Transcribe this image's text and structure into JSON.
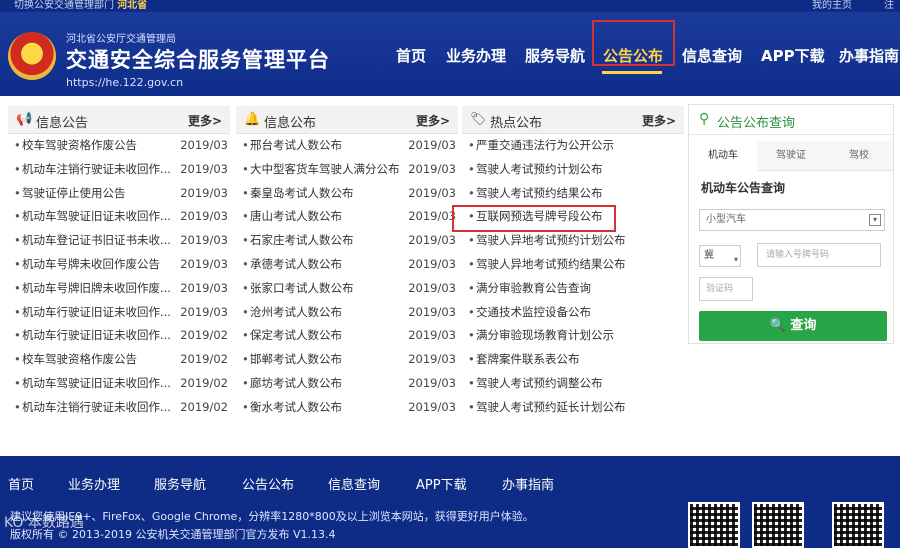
{
  "topbar": {
    "left": "切换公安交通管理部门",
    "province": "河北省",
    "right": "我的主页",
    "right2": "注"
  },
  "header": {
    "subtitle": "河北省公安厅交通管理局",
    "title": "交通安全综合服务管理平台",
    "url": "https://he.122.gov.cn",
    "nav": [
      "首页",
      "业务办理",
      "服务导航",
      "公告公布",
      "信息查询",
      "APP下载",
      "办事指南"
    ],
    "active_nav": "公告公布"
  },
  "columns": [
    {
      "title": "信息公告",
      "icon": "megaphone-icon",
      "more": "更多>",
      "rows": [
        {
          "text": "校车驾驶资格作废公告",
          "date": "2019/03"
        },
        {
          "text": "机动车注销行驶证未收回作...",
          "date": "2019/03"
        },
        {
          "text": "驾驶证停止使用公告",
          "date": "2019/03"
        },
        {
          "text": "机动车驾驶证旧证未收回作...",
          "date": "2019/03"
        },
        {
          "text": "机动车登记证书旧证书未收...",
          "date": "2019/03"
        },
        {
          "text": "机动车号牌未收回作废公告",
          "date": "2019/03"
        },
        {
          "text": "机动车号牌旧牌未收回作废...",
          "date": "2019/03"
        },
        {
          "text": "机动车行驶证旧证未收回作...",
          "date": "2019/03"
        },
        {
          "text": "机动车行驶证旧证未收回作...",
          "date": "2019/02"
        },
        {
          "text": "校车驾驶资格作废公告",
          "date": "2019/02"
        },
        {
          "text": "机动车驾驶证旧证未收回作...",
          "date": "2019/02"
        },
        {
          "text": "机动车注销行驶证未收回作...",
          "date": "2019/02"
        }
      ]
    },
    {
      "title": "信息公布",
      "icon": "bell-icon",
      "more": "更多>",
      "rows": [
        {
          "text": "邢台考试人数公布",
          "date": "2019/03"
        },
        {
          "text": "大中型客货车驾驶人满分公布",
          "date": "2019/03"
        },
        {
          "text": "秦皇岛考试人数公布",
          "date": "2019/03"
        },
        {
          "text": "唐山考试人数公布",
          "date": "2019/03"
        },
        {
          "text": "石家庄考试人数公布",
          "date": "2019/03"
        },
        {
          "text": "承德考试人数公布",
          "date": "2019/03"
        },
        {
          "text": "张家口考试人数公布",
          "date": "2019/03"
        },
        {
          "text": "沧州考试人数公布",
          "date": "2019/03"
        },
        {
          "text": "保定考试人数公布",
          "date": "2019/03"
        },
        {
          "text": "邯郸考试人数公布",
          "date": "2019/03"
        },
        {
          "text": "廊坊考试人数公布",
          "date": "2019/03"
        },
        {
          "text": "衡水考试人数公布",
          "date": "2019/03"
        }
      ]
    },
    {
      "title": "热点公布",
      "icon": "tag-icon",
      "more": "更多>",
      "rows": [
        {
          "text": "严重交通违法行为公开公示"
        },
        {
          "text": "驾驶人考试预约计划公布"
        },
        {
          "text": "驾驶人考试预约结果公布"
        },
        {
          "text": "互联网预选号牌号段公布"
        },
        {
          "text": "驾驶人异地考试预约计划公布"
        },
        {
          "text": "驾驶人异地考试预约结果公布"
        },
        {
          "text": "满分审验教育公告查询"
        },
        {
          "text": "交通技术监控设备公布"
        },
        {
          "text": "满分审验现场教育计划公示"
        },
        {
          "text": "套牌案件联系表公布"
        },
        {
          "text": "驾驶人考试预约调整公布"
        },
        {
          "text": "驾驶人考试预约延长计划公布"
        }
      ]
    }
  ],
  "query": {
    "title": "公告公布查询",
    "tabs": [
      "机动车",
      "驾驶证",
      "驾校"
    ],
    "subtitle": "机动车公告查询",
    "vehicle_type": "小型汽车",
    "province": "冀",
    "plate_placeholder": "请输入号牌号码",
    "code_placeholder": "验证码",
    "button": "查询"
  },
  "footer": {
    "nav": [
      "首页",
      "业务办理",
      "服务导航",
      "公告公布",
      "信息查询",
      "APP下载",
      "办事指南"
    ],
    "browser_notice": "建议您使用IE9+、FireFox、Google Chrome，分辨率1280*800及以上浏览本网站，获得更好用户体验。",
    "copyright": "版权所有 © 2013-2019 公安机关交通管理部门官方发布 V1.13.4",
    "watermark": "KO 本数路遇"
  }
}
